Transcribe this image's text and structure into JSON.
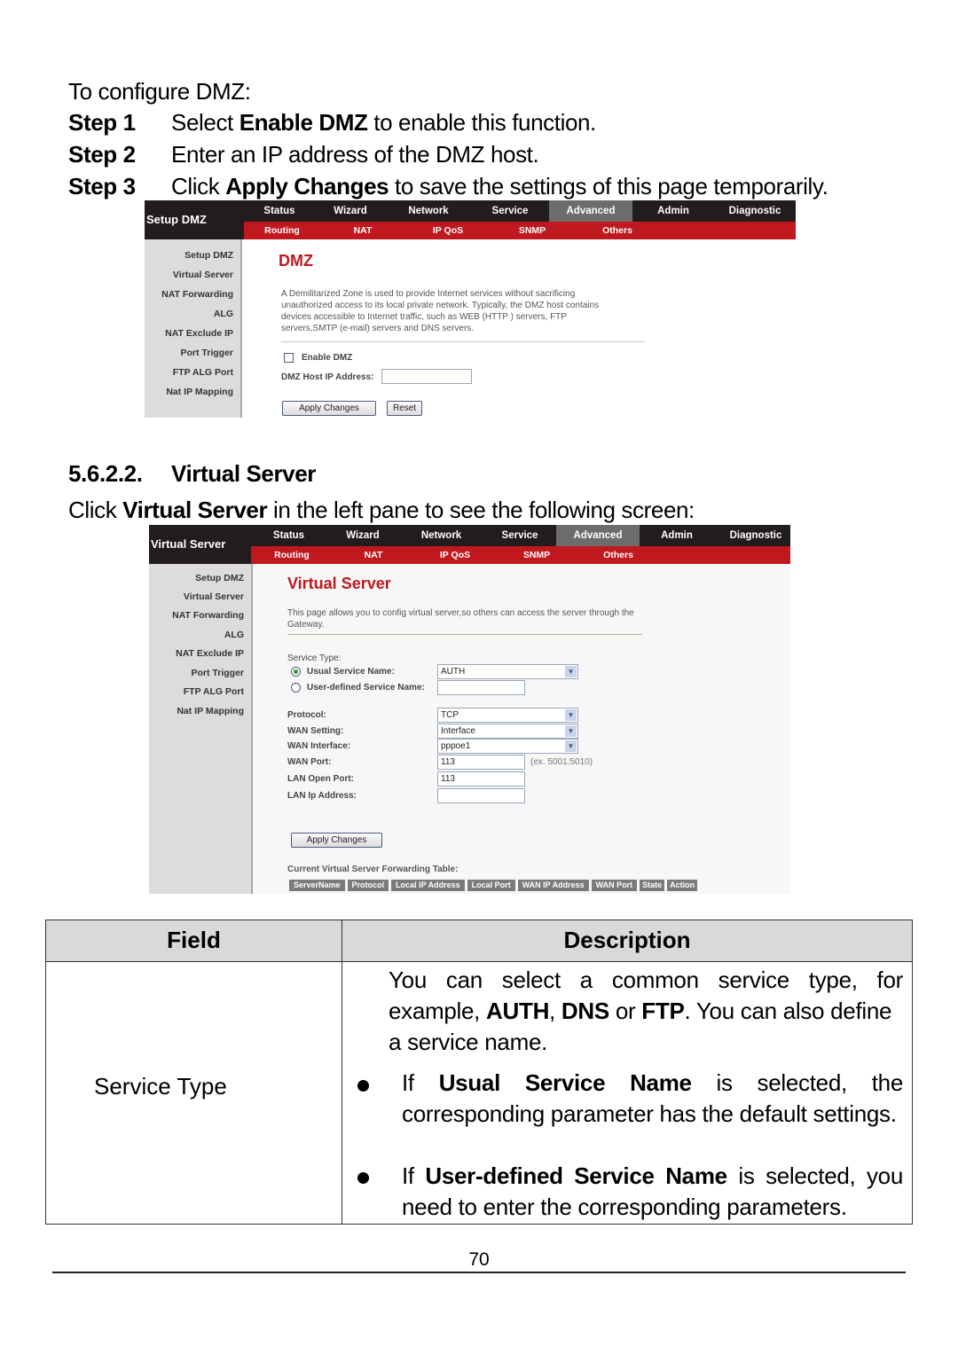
{
  "intro": {
    "lead": "To configure DMZ:",
    "steps": [
      {
        "label": "Step 1",
        "pre": "Select ",
        "bold": "Enable DMZ",
        "post": " to enable this function."
      },
      {
        "label": "Step 2",
        "pre": "Enter an IP address of the DMZ host.",
        "bold": "",
        "post": ""
      },
      {
        "label": "Step 3",
        "pre": "Click ",
        "bold": "Apply Changes",
        "post": " to save the settings of this page temporarily."
      }
    ]
  },
  "router_nav": {
    "tabs": [
      "Status",
      "Wizard",
      "Network",
      "Service",
      "Advanced",
      "Admin",
      "Diagnostic"
    ],
    "active_tab": "Advanced",
    "subtabs": [
      "Routing",
      "NAT",
      "IP QoS",
      "SNMP",
      "Others"
    ],
    "sidebar": [
      "Setup DMZ",
      "Virtual Server",
      "NAT Forwarding",
      "ALG",
      "NAT Exclude IP",
      "Port Trigger",
      "FTP ALG Port",
      "Nat IP Mapping"
    ]
  },
  "dmz_screen": {
    "page_label": "Setup DMZ",
    "title": "DMZ",
    "description_lines": [
      "A Demilitarized Zone is used to provide Internet services without sacrificing",
      "unauthorized access to its local private network. Typically, the DMZ host contains",
      "devices accessible to Internet traffic, such as WEB (HTTP ) servers, FTP",
      "servers,SMTP (e-mail) servers and DNS servers."
    ],
    "enable_label": "Enable DMZ",
    "enable_checked": false,
    "host_ip_label": "DMZ Host IP Address:",
    "host_ip_value": "",
    "apply_label": "Apply Changes",
    "reset_label": "Reset"
  },
  "section": {
    "number": "5.6.2.2.",
    "title": "Virtual Server",
    "intro_pre": "Click ",
    "intro_bold": "Virtual Server",
    "intro_post": " in the left pane to see the following screen:"
  },
  "vs_screen": {
    "page_label": "Virtual Server",
    "title": "Virtual Server",
    "description_lines": [
      "This page allows you to config virtual server,so others can access the server through the",
      "Gateway."
    ],
    "service_type_label": "Service Type:",
    "usual_label": "Usual Service Name:",
    "usual_value": "AUTH",
    "usual_selected": true,
    "user_defined_label": "User-defined Service Name:",
    "user_defined_value": "",
    "protocol_label": "Protocol:",
    "protocol_value": "TCP",
    "wan_setting_label": "WAN Setting:",
    "wan_setting_value": "Interface",
    "wan_interface_label": "WAN Interface:",
    "wan_interface_value": "pppoe1",
    "wan_port_label": "WAN Port:",
    "wan_port_value": "113",
    "wan_port_hint": "(ex. 5001:5010)",
    "lan_open_port_label": "LAN Open Port:",
    "lan_open_port_value": "113",
    "lan_ip_label": "LAN Ip Address:",
    "lan_ip_value": "",
    "apply_label": "Apply Changes",
    "table_caption": "Current Virtual Server Forwarding Table:",
    "table_headers": [
      "ServerName",
      "Protocol",
      "Local IP Address",
      "Local Port",
      "WAN IP Address",
      "WAN Port",
      "State",
      "Action"
    ]
  },
  "field_table": {
    "header_field": "Field",
    "header_description": "Description",
    "rows": [
      {
        "field": "Service Type",
        "intro": {
          "line1": "You can select a common service type, for",
          "line2_parts": [
            "example, ",
            "AUTH",
            ", ",
            "DNS",
            " or ",
            "FTP",
            ". You can also define"
          ],
          "line3": "a service name."
        },
        "bullets": [
          {
            "pre": "If ",
            "bold": "Usual Service Name",
            "post": " is selected, the corresponding parameter has the default settings."
          },
          {
            "pre": "If ",
            "bold": "User-defined Service Name",
            "post": " is selected, you need to enter the corresponding parameters."
          }
        ]
      }
    ]
  },
  "footer": {
    "page_number": "70"
  }
}
